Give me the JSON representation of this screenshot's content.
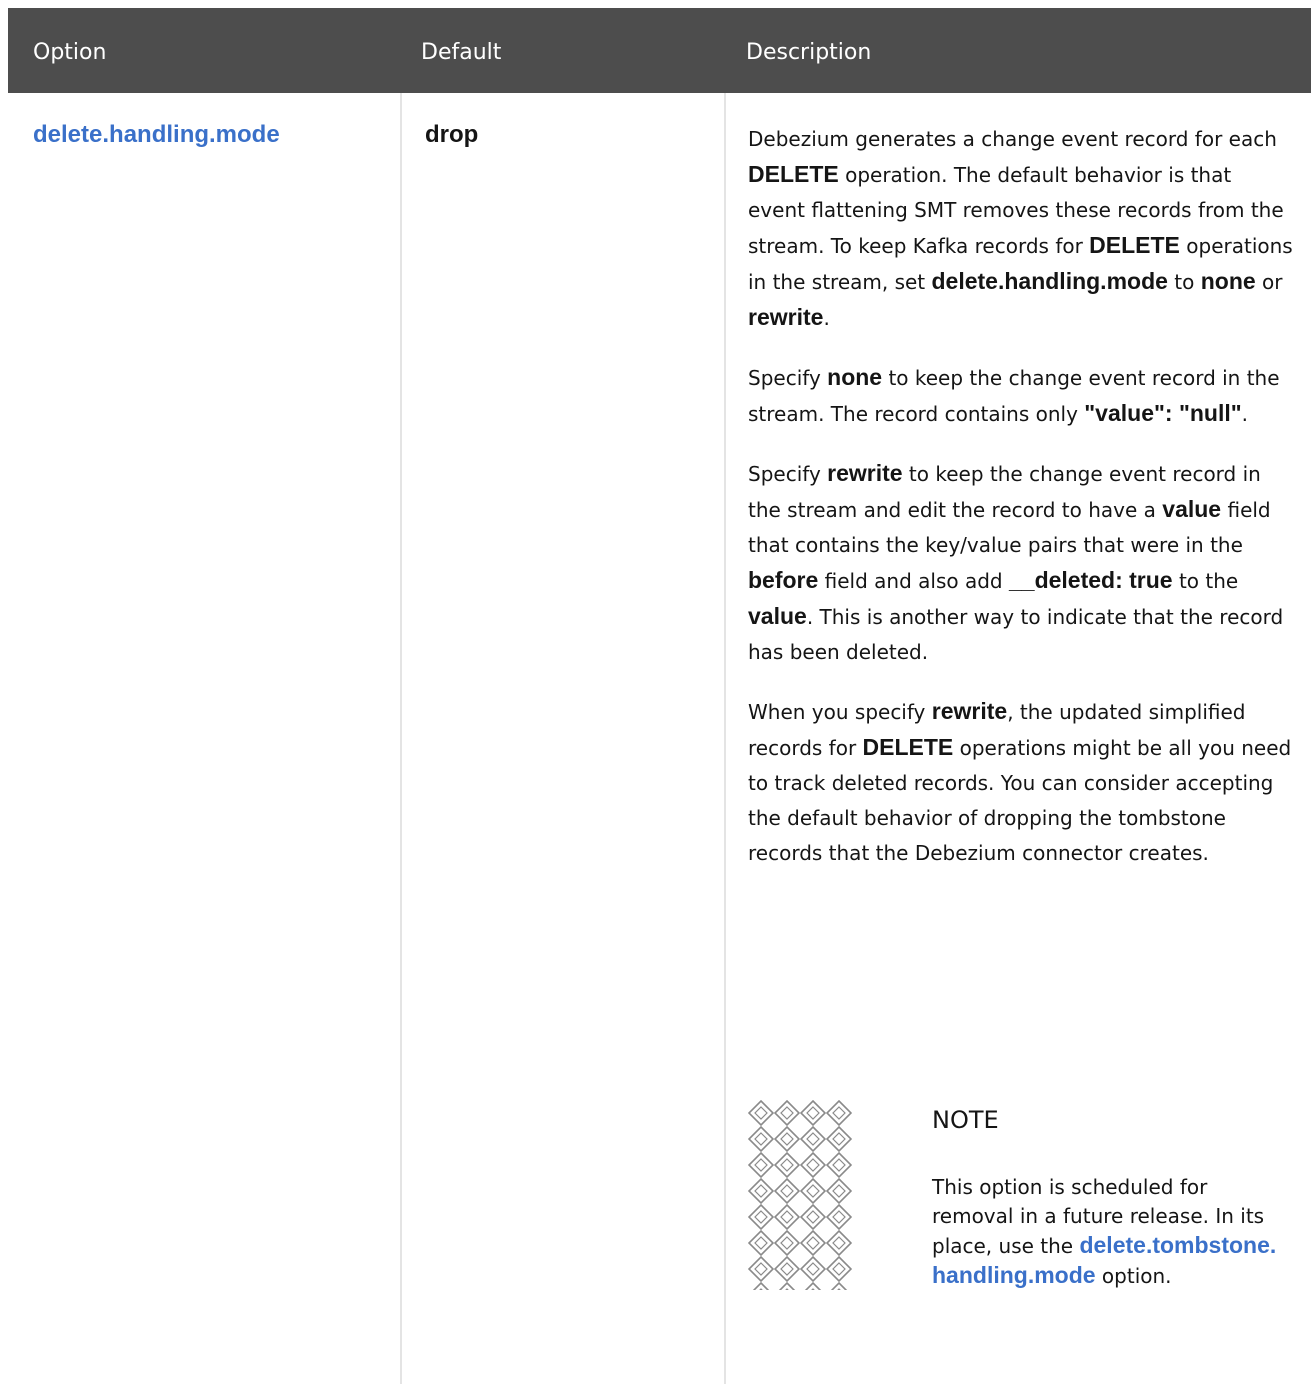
{
  "header": {
    "col_option": "Option",
    "col_default": "Default",
    "col_description": "Description"
  },
  "row": {
    "option": "delete.handling.mode",
    "default": "drop",
    "p1": {
      "t1": "Debezium generates a change event record for each ",
      "b1": "DELETE",
      "t2": " operation. The default behavior is that event flattening SMT removes these records from the stream. To keep Kafka records for ",
      "b2": "DELETE",
      "t3": " operations in the stream, set ",
      "b3": "delete.handling.mode",
      "t4": " to ",
      "b4": "none",
      "t5": " or ",
      "b5": "rewrite",
      "t6": "."
    },
    "p2": {
      "t1": "Specify ",
      "b1": "none",
      "t2": " to keep the change event record in the stream. The record contains only ",
      "b2": "\"value\": \"null\"",
      "t3": "."
    },
    "p3": {
      "t1": "Specify ",
      "b1": "rewrite",
      "t2": " to keep the change event record in the stream and edit the record to have a ",
      "b2": "value",
      "t3": " field that contains the key/value pairs that were in the ",
      "b3": "before",
      "t4": " field and also add ",
      "b4": "__deleted: true",
      "t5": " to the ",
      "b5": "value",
      "t6": ". This is another way to indicate that the record has been deleted."
    },
    "p4": {
      "t1": "When you specify ",
      "b1": "rewrite",
      "t2": ", the updated simplified records for ",
      "b2": "DELETE",
      "t3": " operations might be all you need to track deleted records. You can consider accepting the default behavior of dropping the tombstone records that the Debezium connector creates."
    },
    "note": {
      "icon": "note-pattern-icon",
      "title": "NOTE",
      "t1": "This option is scheduled for removal in a future release. In its place, use the ",
      "link": "delete.tombstone.handling.mode",
      "t2": " option."
    }
  },
  "colors": {
    "header_bg": "#4d4d4d",
    "link": "#3a70c9",
    "text": "#151515",
    "divider": "#e4e4e4"
  }
}
